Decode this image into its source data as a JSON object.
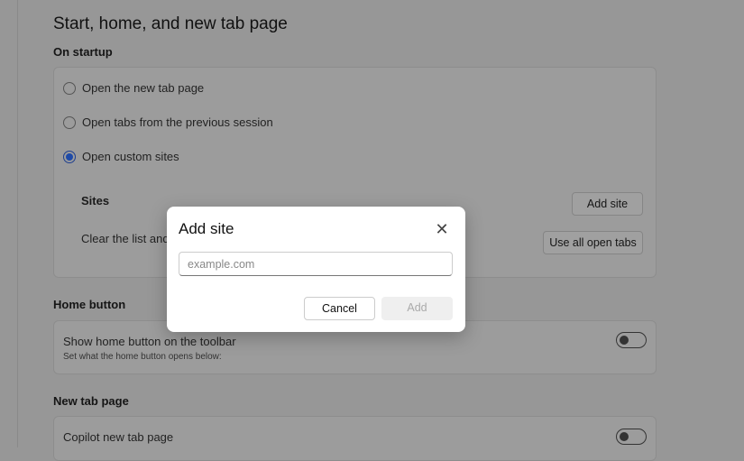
{
  "page": {
    "title": "Start, home, and new tab page"
  },
  "startup": {
    "heading": "On startup",
    "options": [
      {
        "label": "Open the new tab page",
        "selected": false
      },
      {
        "label": "Open tabs from the previous session",
        "selected": false
      },
      {
        "label": "Open custom sites",
        "selected": true
      }
    ],
    "sites_label": "Sites",
    "add_site_button": "Add site",
    "clear_text": "Clear the list and s",
    "use_all_tabs_button": "Use all open tabs"
  },
  "home": {
    "heading": "Home button",
    "toggle_label": "Show home button on the toolbar",
    "toggle_desc": "Set what the home button opens below:",
    "toggle_on": false
  },
  "newtab": {
    "heading": "New tab page",
    "copilot_label": "Copilot new tab page",
    "copilot_on": false
  },
  "dialog": {
    "title": "Add site",
    "input_placeholder": "example.com",
    "input_value": "",
    "cancel": "Cancel",
    "add": "Add",
    "close_icon": "close-icon"
  }
}
